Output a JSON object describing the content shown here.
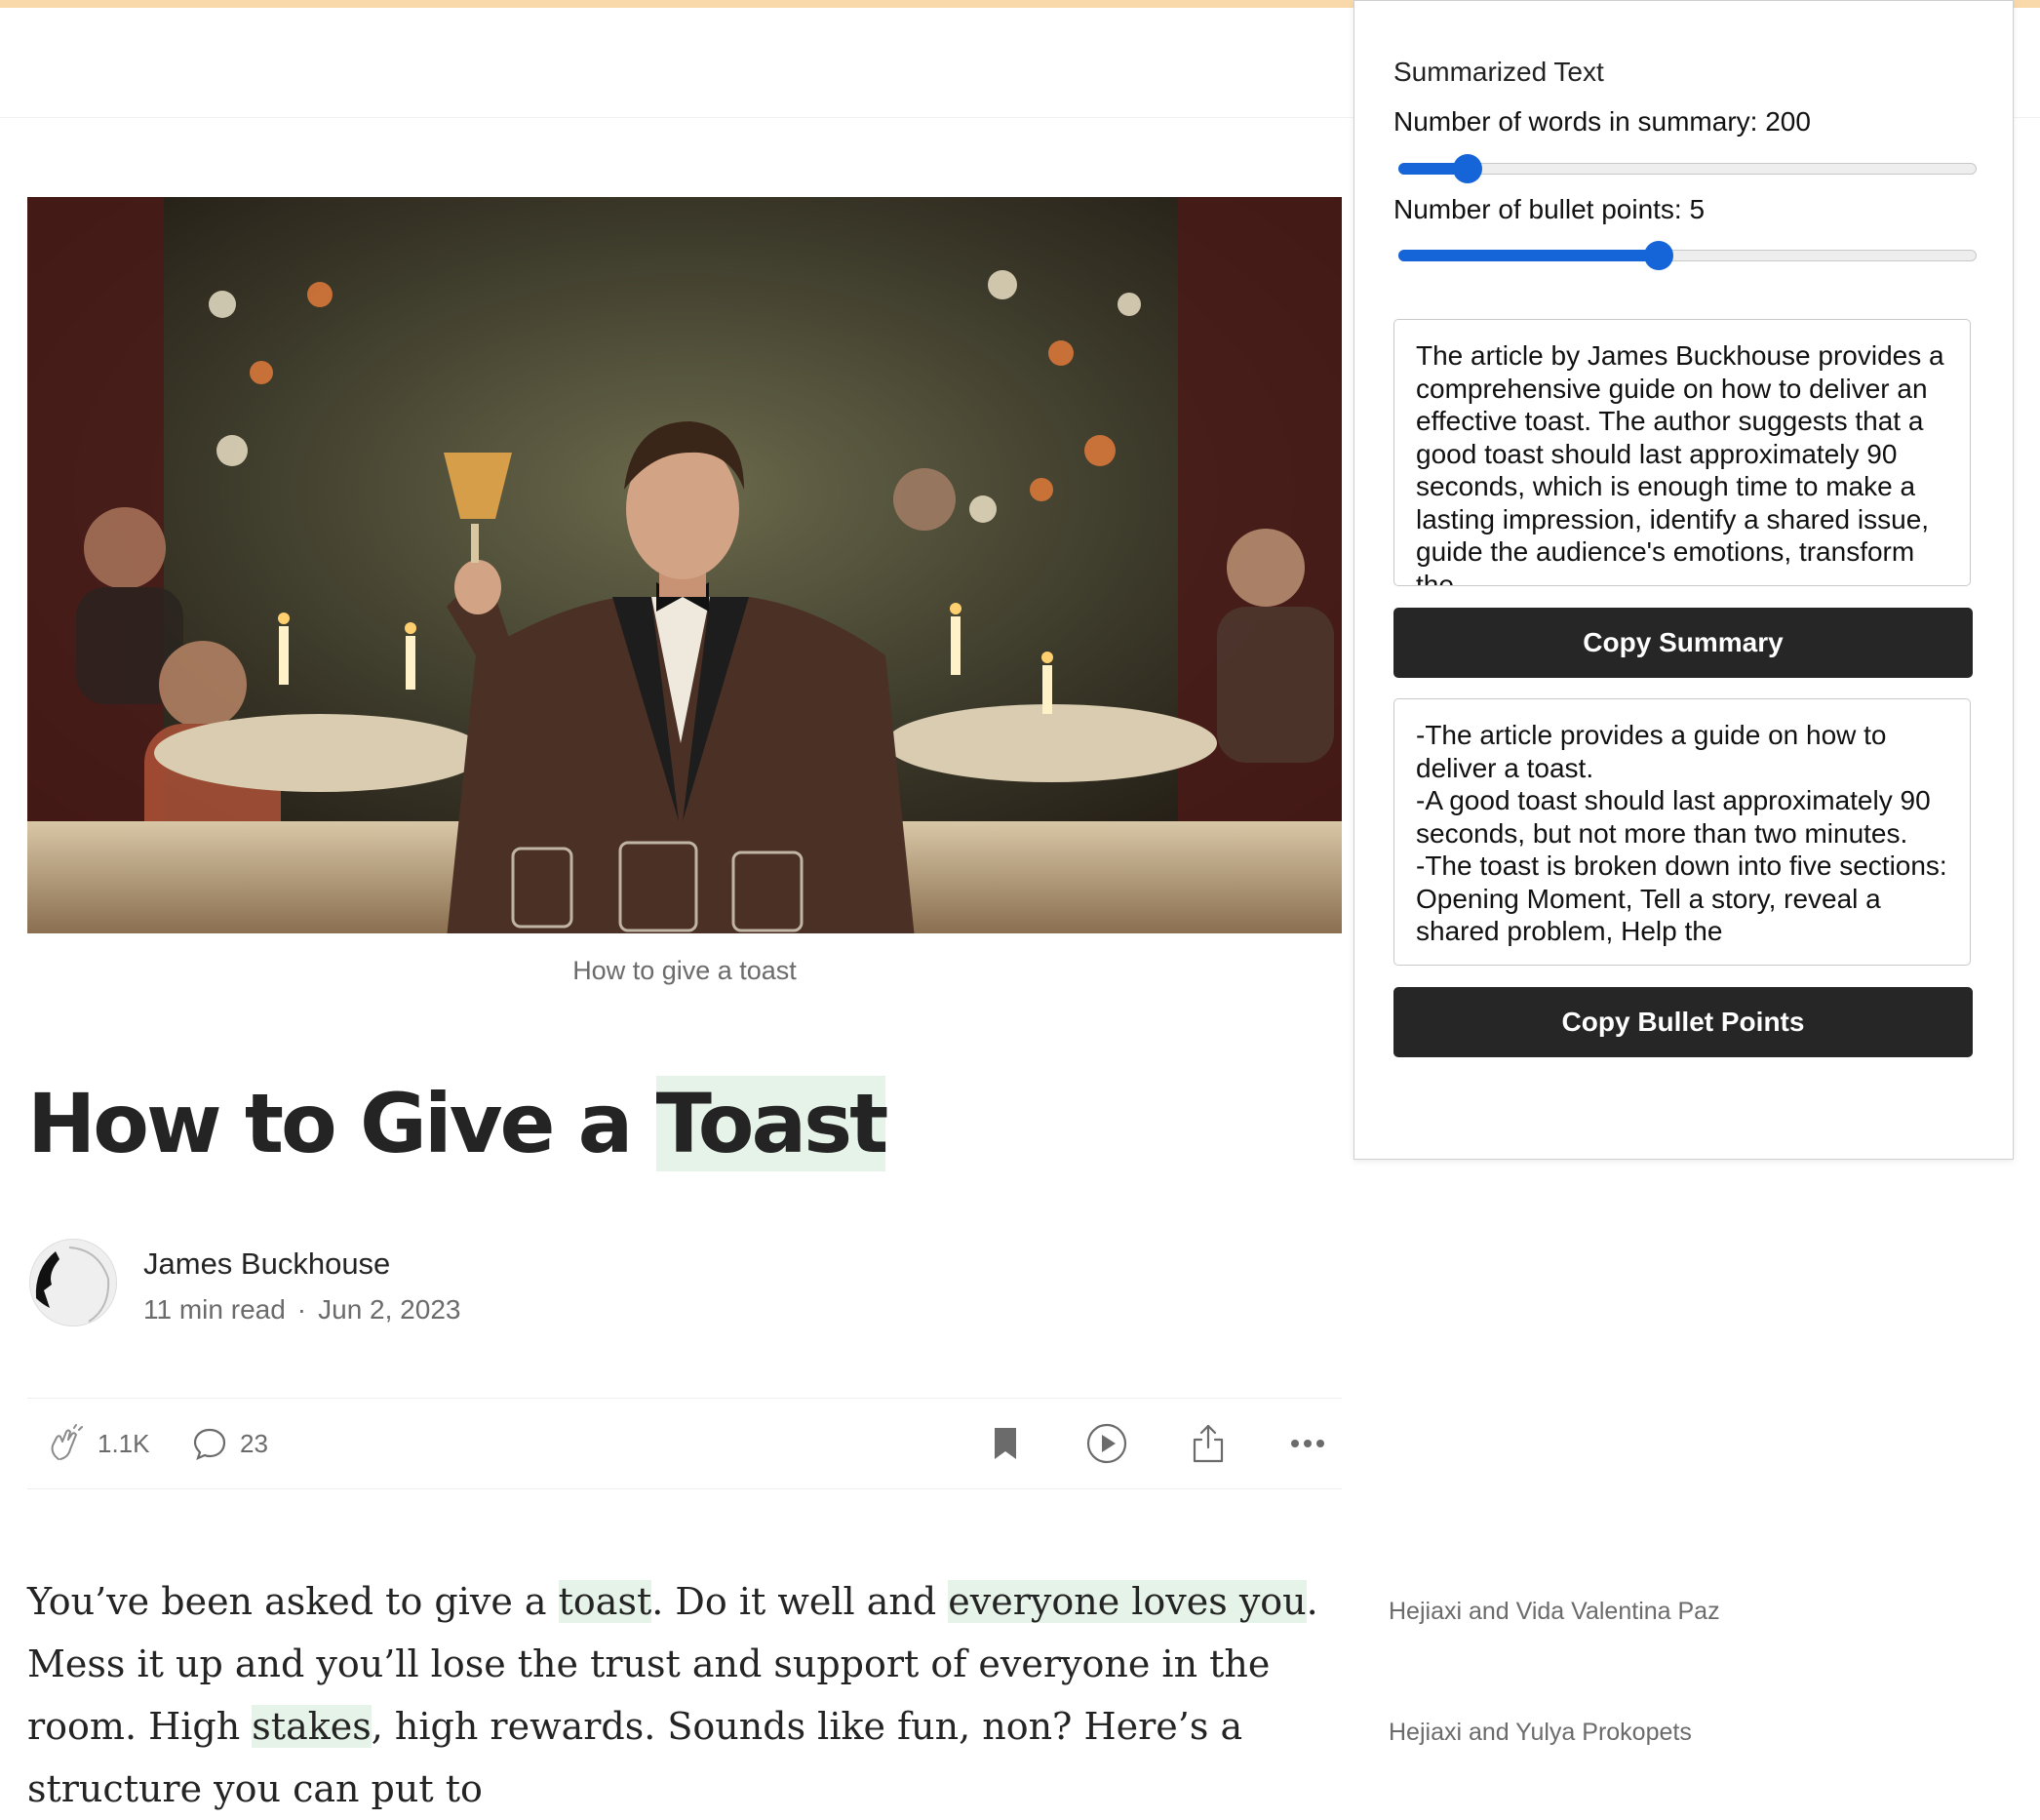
{
  "article": {
    "image_caption": "How to give a toast",
    "title_before": "How to Give a ",
    "title_highlight": "Toast",
    "author": "James Buckhouse",
    "read_time": "11 min read",
    "date": "Jun 2, 2023",
    "claps": "1.1K",
    "comments": "23",
    "body": {
      "p1": "You’ve been asked to give a ",
      "h1": "toast",
      "p2": ". Do it well and ",
      "h2": "everyone loves you",
      "p3": ". Mess it up and you’ll lose the trust and support of everyone in the room. High ",
      "h3": "stakes",
      "p4": ", high rewards. Sounds like fun, non? Here’s a structure you can put to"
    }
  },
  "recommendations": [
    "Hejiaxi and Vida Valentina Paz",
    "Hejiaxi and Yulya Prokopets"
  ],
  "summarizer": {
    "title": "Summarized Text",
    "words_label": "Number of words in summary: 200",
    "words_level": 0.12,
    "bullets_label": "Number of bullet points: 5",
    "bullets_level": 0.45,
    "summary_text": "The article by James Buckhouse provides a comprehensive guide on how to deliver an effective toast. The author suggests that a good toast should last approximately 90 seconds, which is enough time to make a lasting impression, identify a shared issue, guide the audience's emotions, transform the",
    "copy_summary_label": "Copy Summary",
    "bullets_text": "-The article provides a guide on how to deliver a toast.\n-A good toast should last approximately 90 seconds, but not more than two minutes.\n-The toast is broken down into five sections: Opening Moment, Tell a story, reveal a shared problem, Help the",
    "copy_bullets_label": "Copy Bullet Points"
  },
  "colors": {
    "accent": "#1565d8",
    "highlight": "#e6f3e9",
    "button": "#262626"
  },
  "icons": [
    "clap-icon",
    "comment-icon",
    "bookmark-icon",
    "play-icon",
    "share-icon",
    "more-icon"
  ]
}
